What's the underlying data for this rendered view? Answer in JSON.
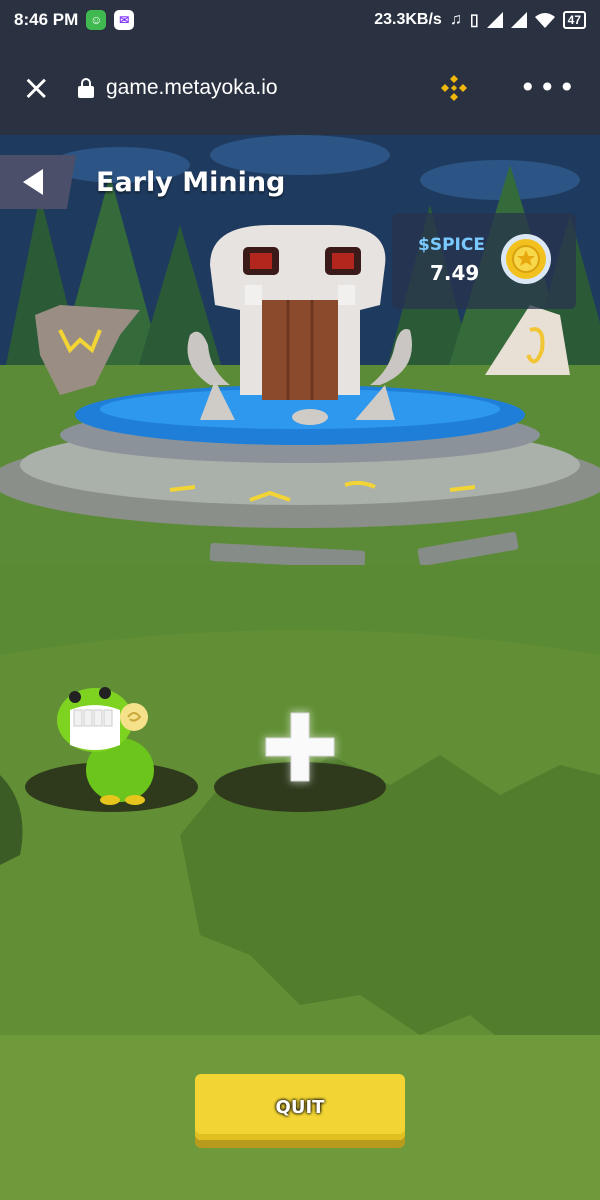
{
  "status_bar": {
    "time": "8:46 PM",
    "network_speed": "23.3KB/s",
    "battery": "47",
    "icons": [
      "app-icon",
      "messenger-icon",
      "headphones-icon",
      "vibrate-icon",
      "signal-icon",
      "signal-icon",
      "wifi-icon",
      "battery-icon"
    ]
  },
  "browser": {
    "url": "game.metayoka.io",
    "close_icon": "×",
    "more_icon": "•••"
  },
  "game": {
    "title": "Early Mining",
    "back_icon": "back-arrow-icon",
    "spice": {
      "label": "$SPICE",
      "value": "7.49"
    },
    "slots": [
      {
        "state": "occupied",
        "character": "green-dino"
      },
      {
        "state": "empty",
        "icon": "plus-icon"
      }
    ],
    "quit_label": "QUIT",
    "colors": {
      "accent_yellow": "#f2d534",
      "spice_blue": "#79c9ff",
      "grass": "#6f9a3b"
    }
  }
}
